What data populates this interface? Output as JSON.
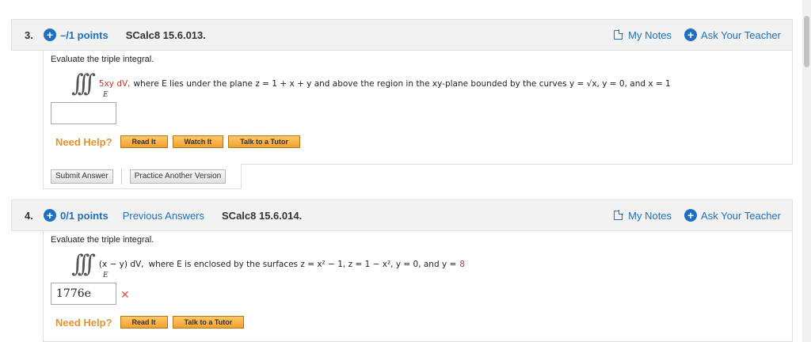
{
  "questions": [
    {
      "number": "3.",
      "points": "–/1 points",
      "problem_id": "SCalc8 15.6.013.",
      "my_notes": "My Notes",
      "ask_teacher": "Ask Your Teacher",
      "prompt": "Evaluate the triple integral.",
      "integral_signs": "∫∫∫",
      "integral_sub": "E",
      "integrand": "5xy dV,",
      "description": "where E lies under the plane z = 1 + x + y and above the region in the xy-plane bounded by the curves y = √x, y = 0, and x = 1",
      "answer_value": "",
      "help_label": "Need Help?",
      "help_buttons": [
        "Read It",
        "Watch It",
        "Talk to a Tutor"
      ],
      "submit_label": "Submit Answer",
      "practice_label": "Practice Another Version"
    },
    {
      "number": "4.",
      "points": "0/1 points",
      "previous_answers": "Previous Answers",
      "problem_id": "SCalc8 15.6.014.",
      "my_notes": "My Notes",
      "ask_teacher": "Ask Your Teacher",
      "prompt": "Evaluate the triple integral.",
      "integral_signs": "∫∫∫",
      "integral_sub": "E",
      "integrand": "(x − y) dV,",
      "description": "where E is enclosed by the surfaces z = x² − 1, z = 1 − x², y = 0, and y =",
      "description_highlight": "8",
      "answer_value": "1776e",
      "answer_status": "✕",
      "help_label": "Need Help?",
      "help_buttons": [
        "Read It",
        "Talk to a Tutor"
      ]
    }
  ],
  "colors": {
    "link": "#1e6fbf",
    "help": "#e8912c",
    "incorrect": "#d9534f",
    "highlight": "#c0392b"
  }
}
